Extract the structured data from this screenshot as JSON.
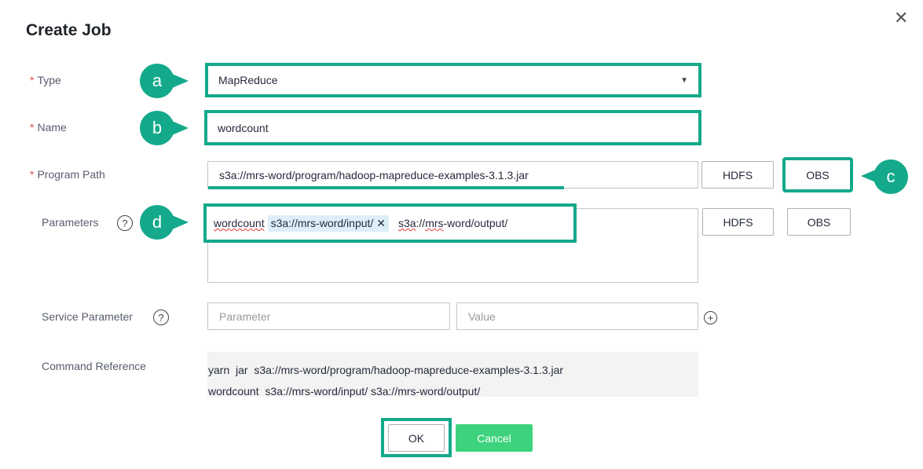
{
  "dialog": {
    "title": "Create Job",
    "close_icon": "close-icon"
  },
  "form": {
    "type": {
      "label": "Type",
      "value": "MapReduce"
    },
    "name": {
      "label": "Name",
      "value": "wordcount"
    },
    "program_path": {
      "label": "Program Path",
      "value": "s3a://mrs-word/program/hadoop-mapreduce-examples-3.1.3.jar",
      "hdfs": "HDFS",
      "obs": "OBS"
    },
    "parameters": {
      "label": "Parameters",
      "help": "?",
      "word": "wordcount",
      "tag": "s3a://mrs-word/input/",
      "tag_remove": "✕",
      "rest_a": "s3a",
      "rest_b": "://",
      "rest_c": "mrs",
      "rest_d": "-word/output/",
      "hdfs": "HDFS",
      "obs": "OBS"
    },
    "service_parameter": {
      "label": "Service Parameter",
      "help": "?",
      "param_placeholder": "Parameter",
      "value_placeholder": "Value",
      "add": "+"
    },
    "command_reference": {
      "label": "Command Reference",
      "line1": "yarn  jar  s3a://mrs-word/program/hadoop-mapreduce-examples-3.1.3.jar",
      "line2": "wordcount  s3a://mrs-word/input/ s3a://mrs-word/output/"
    }
  },
  "footer": {
    "ok": "OK",
    "cancel": "Cancel"
  },
  "markers": {
    "a": "a",
    "b": "b",
    "c": "c",
    "d": "d"
  },
  "colors": {
    "highlight": "#14a98b",
    "cancel": "#3dd37d",
    "required": "#e5494a"
  }
}
